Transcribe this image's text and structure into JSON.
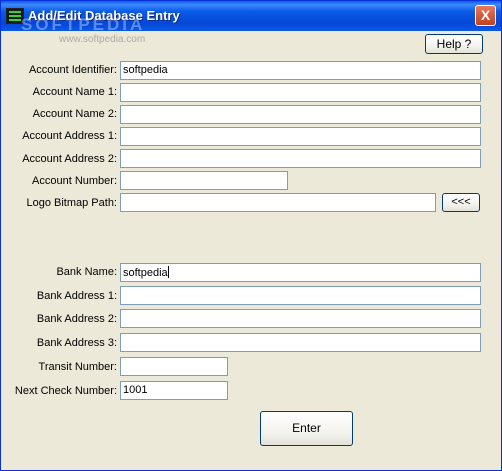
{
  "window": {
    "title": "Add/Edit Database Entry",
    "close_label": "X",
    "watermark_main": "SOFTPEDIA",
    "watermark_url": "www.softpedia.com"
  },
  "toolbar": {
    "help_label": "Help ?"
  },
  "account": {
    "identifier_label": "Account Identifier:",
    "identifier_value": "softpedia",
    "name1_label": "Account Name 1:",
    "name1_value": "",
    "name2_label": "Account Name 2:",
    "name2_value": "",
    "address1_label": "Account Address 1:",
    "address1_value": "",
    "address2_label": "Account Address 2:",
    "address2_value": "",
    "number_label": "Account Number:",
    "number_value": "",
    "logo_label": "Logo Bitmap Path:",
    "logo_value": "",
    "browse_label": "<<<"
  },
  "bank": {
    "name_label": "Bank Name:",
    "name_value": "softpedia",
    "address1_label": "Bank Address 1:",
    "address1_value": "",
    "address2_label": "Bank Address 2:",
    "address2_value": "",
    "address3_label": "Bank Address 3:",
    "address3_value": "",
    "transit_label": "Transit Number:",
    "transit_value": "",
    "next_check_label": "Next Check Number:",
    "next_check_value": "1001"
  },
  "actions": {
    "enter_label": "Enter"
  }
}
